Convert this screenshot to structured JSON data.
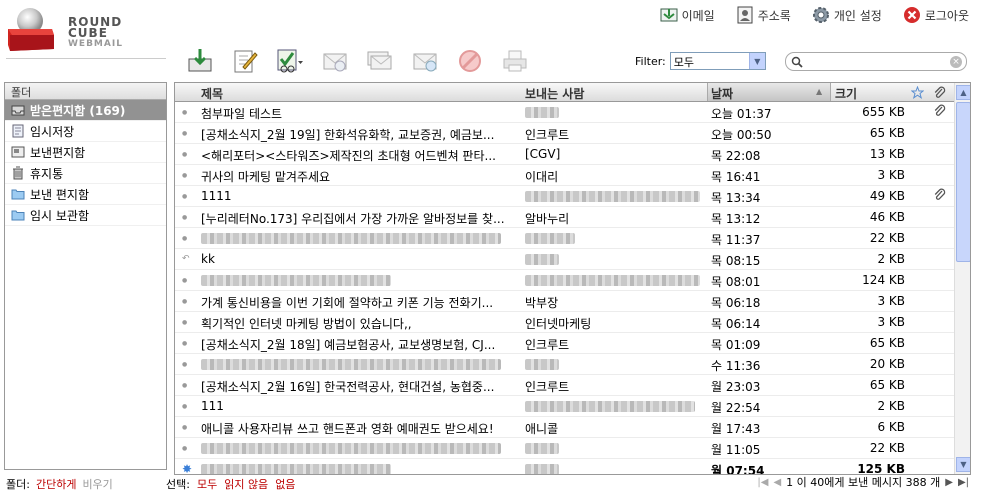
{
  "logo": {
    "line1": "ROUND",
    "line2": "CUBE",
    "line3": "WEBMAIL"
  },
  "topnav": [
    {
      "label": "이메일"
    },
    {
      "label": "주소록"
    },
    {
      "label": "개인 설정"
    },
    {
      "label": "로그아웃"
    }
  ],
  "filter": {
    "label": "Filter:",
    "value": "모두"
  },
  "search": {
    "value": ""
  },
  "folders": {
    "header": "폴더",
    "items": [
      {
        "label": "받은편지함 (169)",
        "icon": "inbox-icon",
        "selected": true
      },
      {
        "label": "임시저장",
        "icon": "drafts-icon"
      },
      {
        "label": "보낸편지함",
        "icon": "sent-icon"
      },
      {
        "label": "휴지통",
        "icon": "trash-icon"
      },
      {
        "label": "보낸 편지함",
        "icon": "folder-icon"
      },
      {
        "label": "임시 보관함",
        "icon": "folder-icon"
      }
    ]
  },
  "list": {
    "columns": {
      "subject": "제목",
      "from": "보내는 사람",
      "date": "날짜",
      "size": "크기"
    },
    "rows": [
      {
        "subject": "첨부파일 테스트",
        "from": "",
        "date": "오늘 01:37",
        "size": "655 KB",
        "att": true
      },
      {
        "subject": "[공채소식지_2월 19일] 한화석유화학, 교보증권, 예금보...",
        "from": "인크루트",
        "date": "오늘 00:50",
        "size": "65 KB"
      },
      {
        "subject": "<해리포터><스타워즈>제작진의 초대형 어드벤쳐 판타...",
        "from": "[CGV]",
        "date": "목 22:08",
        "size": "13 KB"
      },
      {
        "subject": "귀사의 마케팅 맡겨주세요",
        "from": "이대리",
        "date": "목 16:41",
        "size": "3 KB"
      },
      {
        "subject": "1111",
        "from": "",
        "date": "목 13:34",
        "size": "49 KB",
        "att": true
      },
      {
        "subject": "[누리레터No.173] 우리집에서 가장 가까운 알바정보를 찾...",
        "from": "알바누리",
        "date": "목 13:12",
        "size": "46 KB"
      },
      {
        "subject": "",
        "from": "",
        "date": "목 11:37",
        "size": "22 KB"
      },
      {
        "subject": "kk",
        "from": "",
        "date": "목 08:15",
        "size": "2 KB",
        "replied": true
      },
      {
        "subject": "",
        "from": "",
        "date": "목 08:01",
        "size": "124 KB"
      },
      {
        "subject": "가계 통신비용을 이번 기회에 절약하고 키폰 기능 전화기...",
        "from": "박부장",
        "date": "목 06:18",
        "size": "3 KB"
      },
      {
        "subject": "획기적인 인터넷 마케팅 방법이 있습니다,,",
        "from": "인터넷마케팅",
        "date": "목 06:14",
        "size": "3 KB"
      },
      {
        "subject": "[공채소식지_2월 18일] 예금보험공사, 교보생명보험, CJ...",
        "from": "인크루트",
        "date": "목 01:09",
        "size": "65 KB"
      },
      {
        "subject": "",
        "from": "",
        "date": "수 11:36",
        "size": "20 KB"
      },
      {
        "subject": "[공채소식지_2월 16일] 한국전력공사, 현대건설, 농협중...",
        "from": "인크루트",
        "date": "월 23:03",
        "size": "65 KB"
      },
      {
        "subject": "111",
        "from": "",
        "date": "월 22:54",
        "size": "2 KB"
      },
      {
        "subject": "애니콜 사용자리뷰 쓰고 핸드폰과 영화 예매권도 받으세요!",
        "from": "애니콜",
        "date": "월 17:43",
        "size": "6 KB"
      },
      {
        "subject": "",
        "from": "",
        "date": "월 11:05",
        "size": "22 KB"
      },
      {
        "subject": "",
        "from": "",
        "date": "월 07:54",
        "size": "125 KB",
        "unread": true
      }
    ]
  },
  "footer": {
    "folder_label": "폴더:",
    "compact": "간단하게",
    "empty": "비우기",
    "select_label": "선택:",
    "all": "모두",
    "unread": "읽지 않음",
    "none": "없음",
    "pager_text": "1 이 40에게 보낸 메시지 388 개"
  }
}
